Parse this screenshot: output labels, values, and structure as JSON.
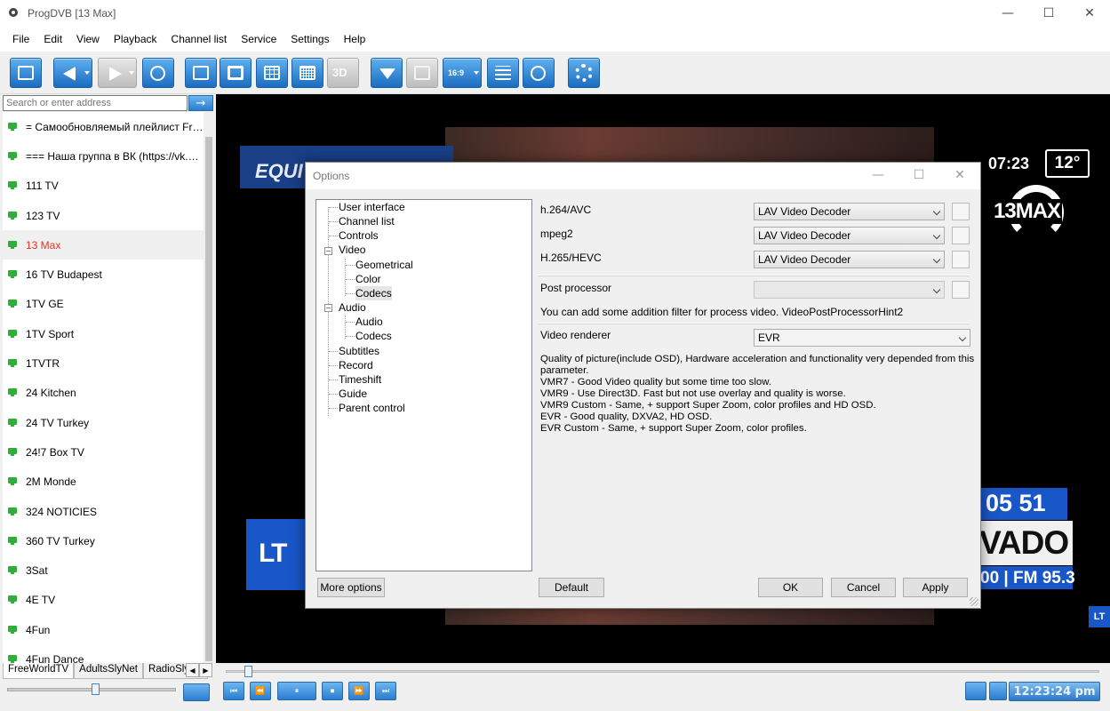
{
  "window": {
    "title": "ProgDVB [13 Max]",
    "controls": [
      "—",
      "☐",
      "✕"
    ]
  },
  "menu": [
    "File",
    "Edit",
    "View",
    "Playback",
    "Channel list",
    "Service",
    "Settings",
    "Help"
  ],
  "sidebar": {
    "search_placeholder": "Search or enter address",
    "search_button": "→",
    "channels": [
      "= Самообновляемый плейлист Free...",
      "=== Наша группа в ВК (https://vk.com...",
      "111 TV",
      "123 TV",
      "13 Max",
      "16 TV Budapest",
      "1TV GE",
      "1TV Sport",
      "1TVTR",
      "24 Kitchen",
      "24 TV Turkey",
      "24!7 Box TV",
      "2M Monde",
      "324 NOTICIES",
      "360 TV Turkey",
      "3Sat",
      "4E TV",
      "4Fun",
      "4Fun Dance"
    ],
    "active_channel": "13 Max",
    "tabs": [
      "FreeWorldTV",
      "AdultsSlyNet",
      "RadioSlyNe"
    ],
    "tab_arrows": [
      "◀",
      "▶"
    ],
    "volume_fraction": 0.52
  },
  "video": {
    "banner_text": "EQUI",
    "clock": "07:23",
    "temperature": "12°",
    "channel_logo": "13MAX",
    "lt_logo": "LT",
    "radio_number": "05 51",
    "radio_name": "VADO",
    "radio_freq": "00 | FM 95.3",
    "corner_logo": "LT"
  },
  "playback": {
    "progress_fraction": 0.02,
    "buttons": [
      "⏮",
      "⏪",
      "⏸",
      "⏹",
      "⏩",
      "⏭"
    ],
    "time": "12:23:24 pm"
  },
  "dialog": {
    "title": "Options",
    "controls": [
      "—",
      "☐",
      "✕"
    ],
    "tree": [
      {
        "label": "User interface",
        "level": 0
      },
      {
        "label": "Channel list",
        "level": 0
      },
      {
        "label": "Controls",
        "level": 0
      },
      {
        "label": "Video",
        "level": 0,
        "expanded": true
      },
      {
        "label": "Geometrical",
        "level": 1
      },
      {
        "label": "Color",
        "level": 1
      },
      {
        "label": "Codecs",
        "level": 1,
        "selected": true
      },
      {
        "label": "Audio",
        "level": 0,
        "expanded": true
      },
      {
        "label": "Audio",
        "level": 1
      },
      {
        "label": "Codecs",
        "level": 1
      },
      {
        "label": "Subtitles",
        "level": 0
      },
      {
        "label": "Record",
        "level": 0
      },
      {
        "label": "Timeshift",
        "level": 0
      },
      {
        "label": "Guide",
        "level": 0
      },
      {
        "label": "Parent control",
        "level": 0
      }
    ],
    "tree_expander": "−",
    "codecs": [
      {
        "label": "h.264/AVC",
        "value": "LAV Video Decoder"
      },
      {
        "label": "mpeg2",
        "value": "LAV Video Decoder"
      },
      {
        "label": "H.265/HEVC",
        "value": "LAV Video Decoder"
      }
    ],
    "post_processor": {
      "label": "Post processor",
      "value": ""
    },
    "hint": "You can add some addition filter for process video. VideoPostProcessorHint2",
    "renderer": {
      "label": "Video renderer",
      "value": "EVR"
    },
    "description": [
      "Quality of picture(include OSD), Hardware acceleration and functionality very depended from this",
      "parameter.",
      "VMR7 - Good Video quality but some time too slow.",
      "VMR9 - Use Direct3D. Fast but not use overlay and quality is worse.",
      "VMR9 Custom - Same, + support Super Zoom, color profiles and HD OSD.",
      "EVR - Good quality, DXVA2, HD OSD.",
      "EVR Custom - Same, + support Super Zoom, color profiles."
    ],
    "buttons": {
      "more": "More options",
      "default": "Default",
      "ok": "OK",
      "cancel": "Cancel",
      "apply": "Apply"
    }
  },
  "toolbar": {
    "icons": [
      "channel-list-icon",
      "back-icon",
      "forward-icon",
      "search-icon",
      "window-icon",
      "fullscreen-icon",
      "split-view-icon",
      "mosaic-icon",
      "3d-icon",
      "record-icon",
      "teletext-icon",
      "subtitles-icon",
      "epg-icon",
      "scheduler-icon",
      "settings-icon"
    ],
    "label_3d": "3D",
    "label_aspect": "16:9"
  },
  "colors": {
    "accent_blue": "#2a7cd0",
    "active_channel": "#e0352b",
    "tv_icon": "#2fae3c"
  }
}
